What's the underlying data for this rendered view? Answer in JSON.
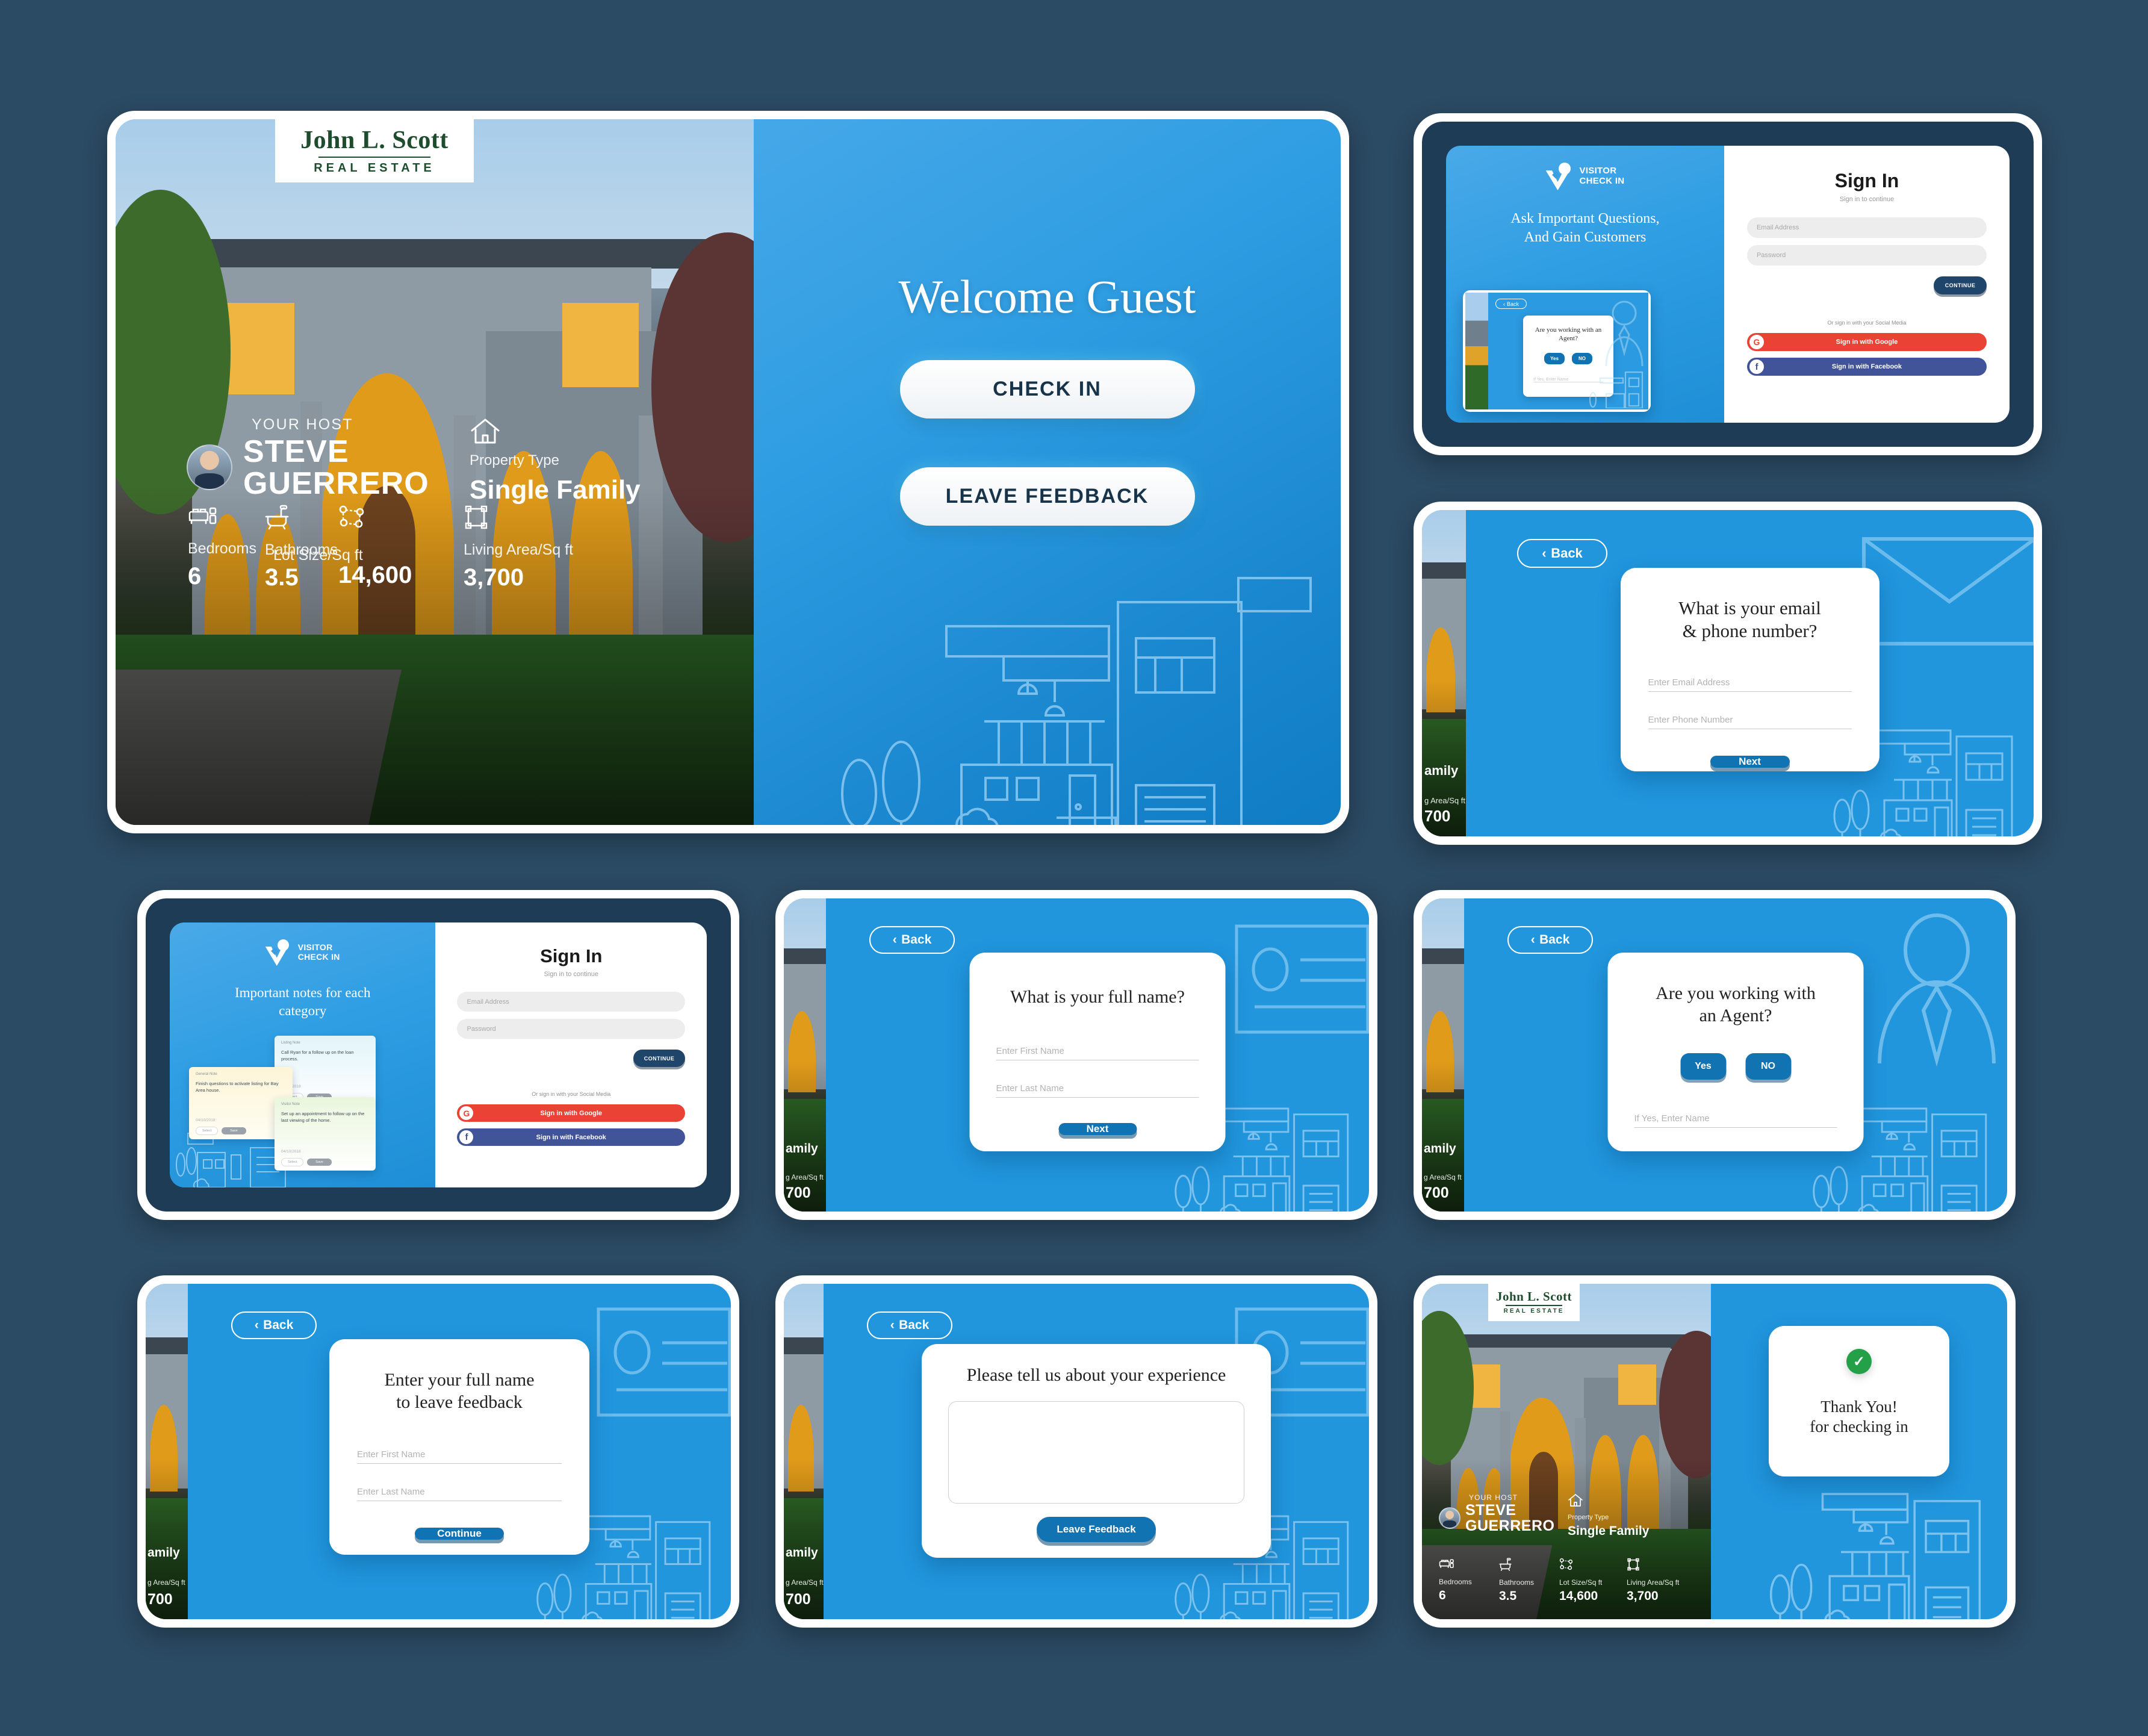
{
  "brand": {
    "logo_line1": "John L. Scott",
    "logo_line2": "REAL ESTATE",
    "app_logo_line1": "VISITOR",
    "app_logo_line2": "CHECK IN",
    "accent_blue": "#2196dd",
    "deep_blue": "#1273b2",
    "navy": "#20456a",
    "page_bg": "#2b4a63",
    "google_red": "#ea4335",
    "facebook_blue": "#41549a",
    "success_green": "#24a148"
  },
  "property": {
    "your_host_label": "YOUR HOST",
    "host_first": "STEVE",
    "host_last": "GUERRERO",
    "property_type_label": "Property Type",
    "property_type_value": "Single Family",
    "stats": [
      {
        "icon": "bed-icon",
        "label": "Bedrooms",
        "value": "6"
      },
      {
        "icon": "bathtub-icon",
        "label": "Bathrooms",
        "value": "3.5"
      },
      {
        "icon": "lot-size-icon",
        "label": "Lot Size/Sq ft",
        "value": "14,600"
      },
      {
        "icon": "living-area-icon",
        "label": "Living Area/Sq ft",
        "value": "3,700"
      }
    ]
  },
  "welcome_screen": {
    "title": "Welcome Guest",
    "check_in_button": "CHECK IN",
    "leave_feedback_button": "LEAVE FEEDBACK"
  },
  "sign_in": {
    "promo_headline_a": "Ask Important Questions,",
    "promo_headline_b": "And Gain Customers",
    "promo_headline_notes_a": "Important notes for each",
    "promo_headline_notes_b": "category",
    "title": "Sign In",
    "subtitle": "Sign in to continue",
    "email_placeholder": "Email Address",
    "password_placeholder": "Password",
    "continue_button": "CONTINUE",
    "or_text": "Or sign in with your Social Media",
    "google_button": "Sign in with Google",
    "facebook_button": "Sign in with Facebook",
    "google_badge": "G",
    "facebook_badge": "f"
  },
  "mini_preview": {
    "back": "Back",
    "question": "Are you working with an Agent?",
    "yes": "Yes",
    "no": "NO",
    "name_placeholder": "If Yes, Enter Name"
  },
  "notes": [
    {
      "category": "General Note",
      "body": "Finish questions to activate listing for Bay Area house.",
      "date": "04/10/2018",
      "select": "Select",
      "save": "Save",
      "color": "yellow"
    },
    {
      "category": "Listing Note",
      "body": "Call Ryan for a follow up on the loan process.",
      "date": "10/13/2018",
      "select": "Select",
      "save": "Save",
      "color": "cyan"
    },
    {
      "category": "Visitor Note",
      "body": "Set up an appointment to follow up on the last viewing of the home.",
      "date": "04/10/2018",
      "select": "Select",
      "save": "Save",
      "color": "green"
    }
  ],
  "back_button": "Back",
  "screens": {
    "email_phone": {
      "question_a": "What is your email",
      "question_b": "& phone number?",
      "email_placeholder": "Enter Email Address",
      "phone_placeholder": "Enter Phone Number",
      "next_button": "Next"
    },
    "full_name": {
      "question": "What is your full name?",
      "first_placeholder": "Enter First Name",
      "last_placeholder": "Enter Last Name",
      "next_button": "Next"
    },
    "agent": {
      "question_a": "Are you working with",
      "question_b": "an Agent?",
      "yes_button": "Yes",
      "no_button": "NO",
      "name_placeholder": "If Yes, Enter Name"
    },
    "feedback_name": {
      "question_a": "Enter your full name",
      "question_b": "to leave feedback",
      "first_placeholder": "Enter First Name",
      "last_placeholder": "Enter Last Name",
      "continue_button": "Continue"
    },
    "feedback_text": {
      "question": "Please tell us about your experience",
      "textarea_placeholder": "",
      "leave_feedback_button": "Leave Feedback"
    },
    "thank_you": {
      "line_a": "Thank You!",
      "line_b": "for checking in",
      "check_icon": "check-circle-icon"
    }
  },
  "partial_labels": {
    "family": "amily",
    "living_area": "g Area/Sq ft",
    "living_value": "700"
  }
}
